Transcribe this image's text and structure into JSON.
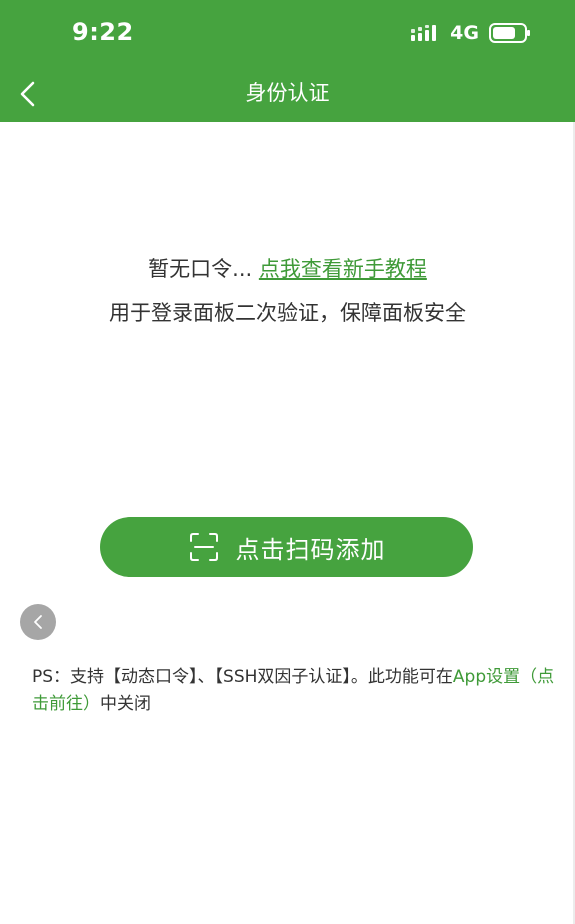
{
  "status_bar": {
    "time": "9:22",
    "network": "4G",
    "icons": [
      "signal-icon",
      "battery-icon"
    ]
  },
  "nav": {
    "title": "身份认证",
    "back_icon": "chevron-left-icon"
  },
  "empty_state": {
    "no_token_text": "暂无口令...",
    "tutorial_link": "点我查看新手教程",
    "description": "用于登录面板二次验证，保障面板安全"
  },
  "scan_button": {
    "label": "点击扫码添加",
    "icon": "scan-icon"
  },
  "floating_back": {
    "icon": "chevron-left-icon"
  },
  "footnote": {
    "text": "PS：支持【动态口令】、【SSH双因子认证】。此功能可在",
    "link": "App设置（点击前往）",
    "suffix": "中关闭"
  },
  "colors": {
    "brand_green": "#46a33f",
    "link_green": "#3f9a38",
    "text_dark": "#333333",
    "float_grey": "#a6a6a6"
  }
}
